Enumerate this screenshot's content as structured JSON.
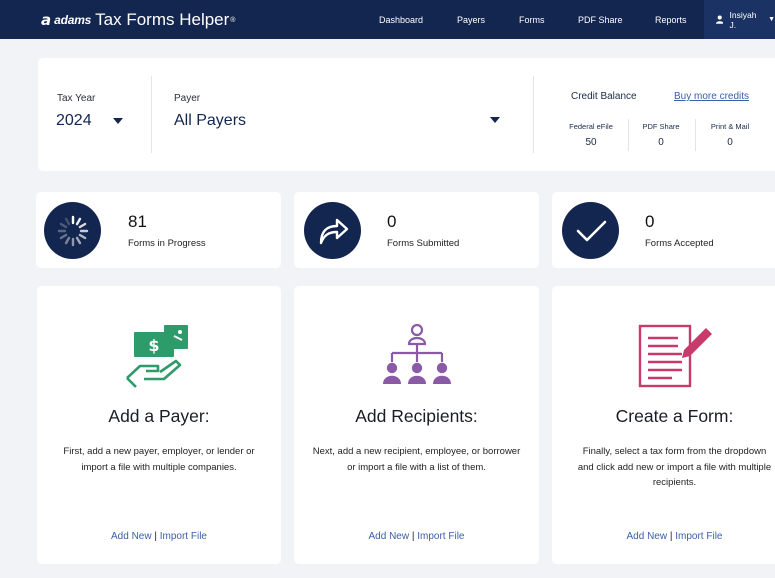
{
  "header": {
    "brand_mark": "a",
    "brand_adams": "adams",
    "brand_name": "Tax Forms Helper",
    "brand_reg": "®",
    "nav": [
      "Dashboard",
      "Payers",
      "Forms",
      "PDF Share",
      "Reports"
    ],
    "user_name": "Insiyah J.",
    "colors": {
      "nav_bg": "#13264f",
      "user_bg": "#1b3364"
    }
  },
  "filters": {
    "tax_year_label": "Tax Year",
    "tax_year_value": "2024",
    "payer_label": "Payer",
    "payer_value": "All Payers"
  },
  "credits": {
    "title": "Credit Balance",
    "buy_link": "Buy more credits",
    "columns": [
      {
        "label": "Federal eFile",
        "value": "50"
      },
      {
        "label": "PDF Share",
        "value": "0"
      },
      {
        "label": "Print & Mail",
        "value": "0"
      }
    ]
  },
  "stats": [
    {
      "value": "81",
      "label": "Forms in Progress",
      "icon": "spinner-icon"
    },
    {
      "value": "0",
      "label": "Forms Submitted",
      "icon": "share-arrow-icon"
    },
    {
      "value": "0",
      "label": "Forms Accepted",
      "icon": "checkmark-icon"
    }
  ],
  "actions": [
    {
      "icon": "money-hand-icon",
      "title": "Add a Payer:",
      "description": "First, add a new payer, employer, or lender or import a file with multiple companies.",
      "add_new": "Add New",
      "separator": "|",
      "import_file": "Import File"
    },
    {
      "icon": "org-chart-icon",
      "title": "Add Recipients:",
      "description": "Next, add a new recipient, employee, or borrower or import a file with a list of them.",
      "add_new": "Add New",
      "separator": "|",
      "import_file": "Import File"
    },
    {
      "icon": "form-pencil-icon",
      "title": "Create a Form:",
      "description": "Finally, select a tax form from the dropdown and click add new or import a file with multiple recipients.",
      "add_new": "Add New",
      "separator": "|",
      "import_file": "Import File"
    }
  ],
  "colors": {
    "background": "#f1f3f6",
    "navy": "#13264f",
    "link": "#3a5fa8",
    "green": "#2e9b6a",
    "purple": "#8a5aa6",
    "magenta": "#c83a6c"
  }
}
